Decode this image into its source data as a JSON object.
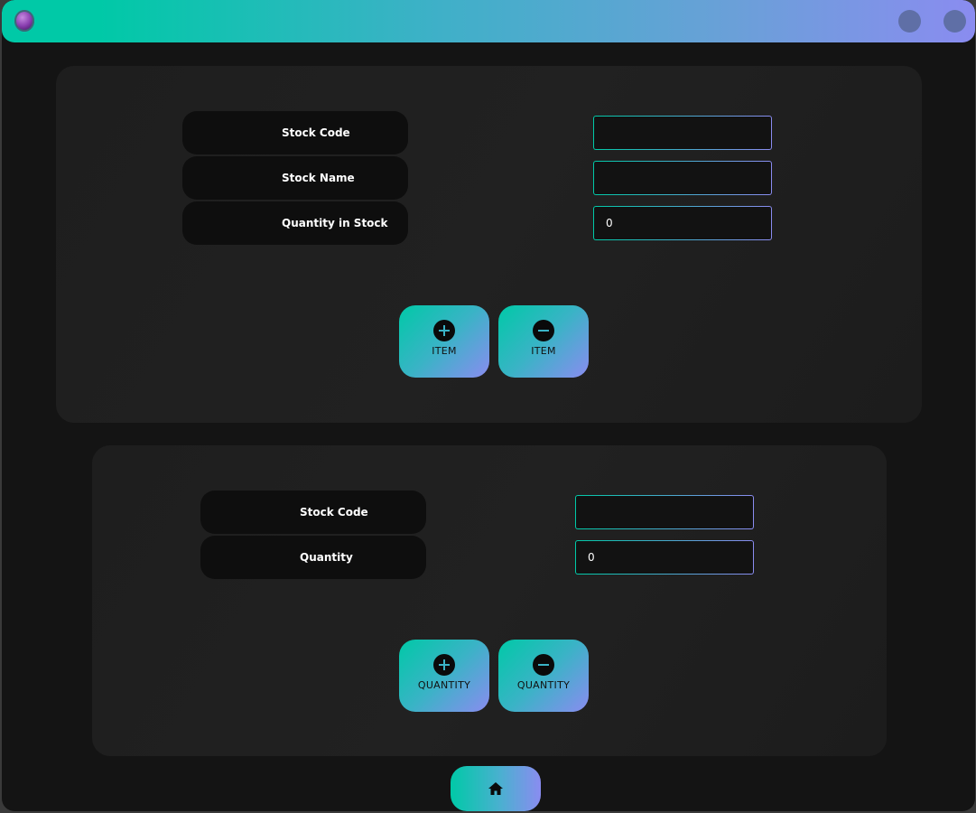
{
  "window": {
    "app_icon": "purple-orb-icon",
    "controls": [
      "minimize-button",
      "close-button"
    ]
  },
  "item_panel": {
    "labels": {
      "stock_code": "Stock Code",
      "stock_name": "Stock Name",
      "quantity_in_stock": "Quantity in Stock"
    },
    "fields": {
      "stock_code": "",
      "stock_name": "",
      "quantity_in_stock": "0"
    },
    "buttons": {
      "add_item": "ITEM",
      "remove_item": "ITEM"
    }
  },
  "quantity_panel": {
    "labels": {
      "stock_code": "Stock Code",
      "quantity": "Quantity"
    },
    "fields": {
      "stock_code": "",
      "quantity": "0"
    },
    "buttons": {
      "add_quantity": "QUANTITY",
      "remove_quantity": "QUANTITY"
    }
  },
  "footer": {
    "home_icon": "home-icon"
  },
  "colors": {
    "gradient_start": "#00c9a7",
    "gradient_end": "#8a8cf0",
    "window_bg": "#141414",
    "panel_bg": "#1e1e1e",
    "label_bg": "#0e0e0e"
  }
}
